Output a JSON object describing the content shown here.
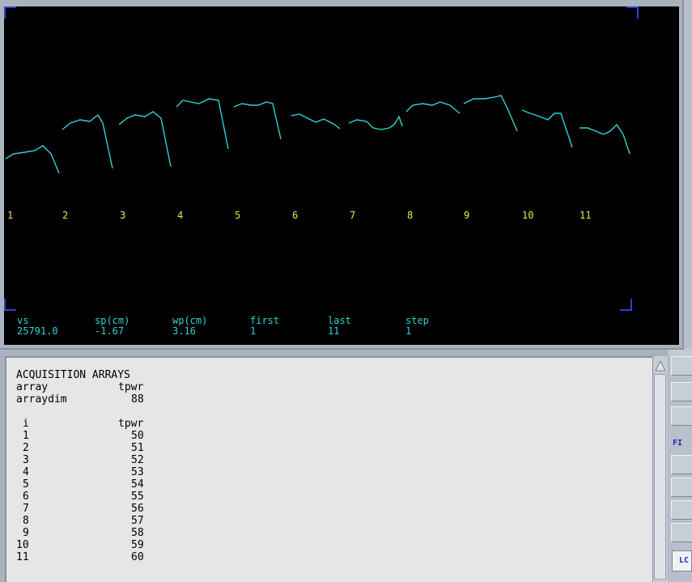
{
  "canvas": {
    "trace_color": "#2fd4d4",
    "label_color": "#e8e84a",
    "frame_color": "#2a3fd4",
    "index_labels": [
      "1",
      "2",
      "3",
      "4",
      "5",
      "6",
      "7",
      "8",
      "9",
      "10",
      "11"
    ]
  },
  "params": [
    {
      "name": "vs",
      "value": "25791.0"
    },
    {
      "name": "sp(cm)",
      "value": "-1.67"
    },
    {
      "name": "wp(cm)",
      "value": "3.16"
    },
    {
      "name": "first",
      "value": "1"
    },
    {
      "name": "last",
      "value": "11"
    },
    {
      "name": "step",
      "value": "1"
    }
  ],
  "text_panel": {
    "title": "ACQUISITION ARRAYS",
    "array_label": "array",
    "array_value": "tpwr",
    "arraydim_label": "arraydim",
    "arraydim_value": "88",
    "col_i": "i",
    "col_tpwr": "tpwr",
    "rows": [
      {
        "i": "1",
        "tpwr": "50"
      },
      {
        "i": "2",
        "tpwr": "51"
      },
      {
        "i": "3",
        "tpwr": "52"
      },
      {
        "i": "4",
        "tpwr": "53"
      },
      {
        "i": "5",
        "tpwr": "54"
      },
      {
        "i": "6",
        "tpwr": "55"
      },
      {
        "i": "7",
        "tpwr": "56"
      },
      {
        "i": "8",
        "tpwr": "57"
      },
      {
        "i": "9",
        "tpwr": "58"
      },
      {
        "i": "10",
        "tpwr": "59"
      },
      {
        "i": "11",
        "tpwr": "60"
      }
    ]
  },
  "side_labels": {
    "fi": "FI",
    "lc": "LC"
  }
}
